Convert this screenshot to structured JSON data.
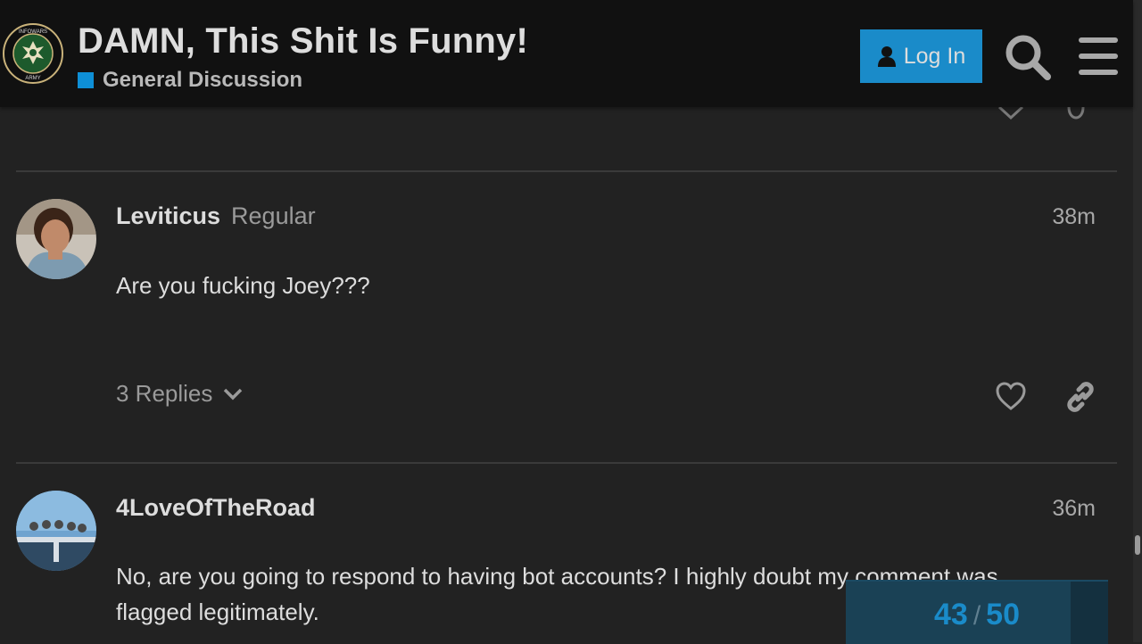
{
  "header": {
    "logo_text_top": "INFOWARS",
    "logo_text_bottom": "ARMY",
    "title": "DAMN, This Shit Is Funny!",
    "category": "General Discussion",
    "category_color": "#0e8fd6",
    "login_label": "Log In",
    "icons": {
      "login": "user-icon",
      "search": "search-icon",
      "menu": "hamburger-menu-icon"
    }
  },
  "posts": [
    {
      "username": "Leviticus",
      "user_title": "Regular",
      "time": "38m",
      "body": "Are you fucking Joey???",
      "replies": "3 Replies"
    },
    {
      "username": "4LoveOfTheRoad",
      "time": "36m",
      "body": "No, are you going to respond to having bot accounts? I highly doubt my comment was flagged legitimately."
    }
  ],
  "progress": {
    "current": "43",
    "separator": "/",
    "total": "50"
  }
}
